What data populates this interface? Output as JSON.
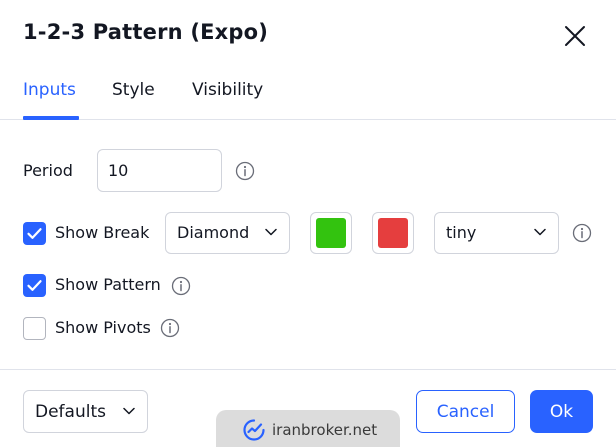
{
  "dialog": {
    "title": "1-2-3 Pattern (Expo)"
  },
  "tabs": [
    {
      "label": "Inputs",
      "active": true
    },
    {
      "label": "Style",
      "active": false
    },
    {
      "label": "Visibility",
      "active": false
    }
  ],
  "inputs": {
    "period": {
      "label": "Period",
      "value": "10"
    },
    "show_break": {
      "label": "Show Break",
      "checked": true,
      "shape": "Diamond",
      "color_up": "#33c30f",
      "color_down": "#e53e3e",
      "size": "tiny"
    },
    "show_pattern": {
      "label": "Show Pattern",
      "checked": true
    },
    "show_pivots": {
      "label": "Show Pivots",
      "checked": false
    }
  },
  "footer": {
    "defaults_label": "Defaults",
    "cancel_label": "Cancel",
    "ok_label": "Ok"
  },
  "watermark": {
    "text": "iranbroker.net"
  },
  "colors": {
    "accent": "#2962ff",
    "border": "#d1d4dc",
    "text": "#131722"
  }
}
